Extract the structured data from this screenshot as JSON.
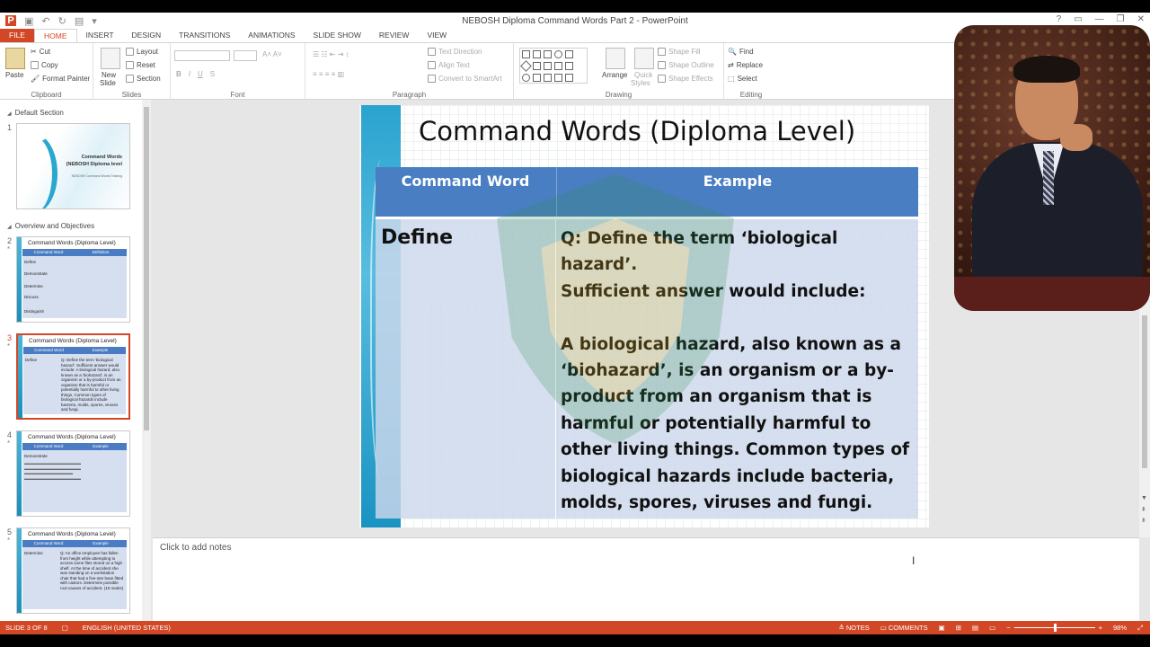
{
  "app": {
    "window_title": "NEBOSH Diploma Command Words Part 2 - PowerPoint",
    "help": "?",
    "accent": "#d24726"
  },
  "tabs": [
    "FILE",
    "HOME",
    "INSERT",
    "DESIGN",
    "TRANSITIONS",
    "ANIMATIONS",
    "SLIDE SHOW",
    "REVIEW",
    "VIEW"
  ],
  "ribbon": {
    "clipboard": {
      "paste": "Paste",
      "cut": "Cut",
      "copy": "Copy",
      "format_painter": "Format Painter",
      "name": "Clipboard"
    },
    "slides": {
      "new_slide": "New",
      "new_slide2": "Slide",
      "layout": "Layout",
      "reset": "Reset",
      "section": "Section",
      "name": "Slides"
    },
    "font": {
      "bold": "B",
      "italic": "I",
      "underline": "U",
      "strike": "S",
      "name": "Font"
    },
    "paragraph": {
      "text_direction": "Text Direction",
      "align_text": "Align Text",
      "convert_smartart": "Convert to SmartArt",
      "name": "Paragraph"
    },
    "drawing": {
      "arrange": "Arrange",
      "quick_styles": "Quick",
      "quick_styles2": "Styles",
      "shape_fill": "Shape Fill",
      "shape_outline": "Shape Outline",
      "shape_effects": "Shape Effects",
      "name": "Drawing"
    },
    "editing": {
      "find": "Find",
      "replace": "Replace",
      "select": "Select",
      "name": "Editing"
    }
  },
  "thumbnails": {
    "sections": [
      "Default Section",
      "Overview and Objectives"
    ],
    "slides": [
      {
        "num": "1",
        "t1": "Command Words",
        "t2": "(NEBOSH Diploma level",
        "t3": "NEBOSH Command Words Training"
      },
      {
        "num": "2",
        "title": "Command Words (Diploma Level)",
        "h1": "Command Word",
        "h2": "Definition",
        "rows": [
          "Define",
          "Demonstrate",
          "Determine",
          "Discuss",
          "Distinguish"
        ]
      },
      {
        "num": "3",
        "title": "Command Words (Diploma Level)",
        "h1": "Command Word",
        "h2": "Example",
        "word": "Define",
        "text": "Q: Define the term 'biological hazard'. Sufficient answer would include: A biological hazard, also known as a 'biohazard', is an organism or a by-product from an organism that is harmful or potentially harmful to other living things. Common types of biological hazards include bacteria, molds, spores, viruses and fungi."
      },
      {
        "num": "4",
        "title": "Command Words (Diploma Level)",
        "h1": "Command Word",
        "h2": "Example",
        "word": "Demonstrate"
      },
      {
        "num": "5",
        "title": "Command Words (Diploma Level)",
        "h1": "Command Word",
        "h2": "Example",
        "word": "Determine",
        "text": "Q: An office employee has fallen from height while attempting to access some files stored on a high shelf. At the time of accident she was standing on a workstation chair that had a five-star base fitted with castors. Determine possible root causes of accident. (10 marks)"
      }
    ]
  },
  "slide": {
    "title": "Command Words (Diploma Level)",
    "col1_header": "Command Word",
    "col2_header": "Example",
    "word": "Define",
    "example": "Q: Define the term ‘biological hazard’.\nSufficient answer would include:\n\nA biological hazard, also known as a ‘biohazard’, is an organism or a by-product from an organism that is harmful or potentially harmful to other living things. Common types of biological hazards include bacteria, molds, spores, viruses and fungi."
  },
  "notes": {
    "placeholder": "Click to add notes"
  },
  "status": {
    "slide_info": "SLIDE 3 OF 8",
    "language": "ENGLISH (UNITED STATES)",
    "notes": "NOTES",
    "comments": "COMMENTS",
    "zoom": "98%"
  }
}
